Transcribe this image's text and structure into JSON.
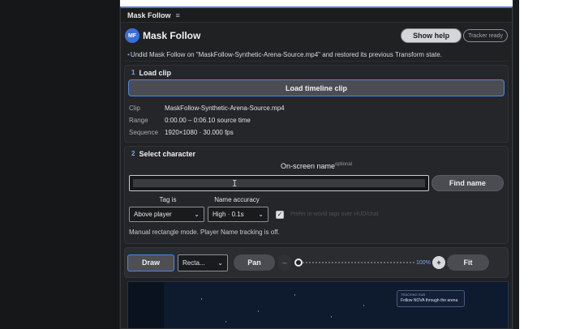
{
  "panel": {
    "tab_title": "Mask Follow"
  },
  "header": {
    "logo_text": "MF",
    "title": "Mask Follow",
    "help_label": "Show help",
    "tracker_status": "Tracker ready"
  },
  "notice": "Undid Mask Follow on \"MaskFollow-Synthetic-Arena-Source.mp4\" and restored its previous Transform state.",
  "load_clip": {
    "step": "1",
    "title": "Load clip",
    "button_label": "Load timeline clip",
    "meta": [
      {
        "key": "Clip",
        "value": "MaskFollow-Synthetic-Arena-Source.mp4"
      },
      {
        "key": "Range",
        "value": "0:00.00 – 0:06.10 source time"
      },
      {
        "key": "Sequence",
        "value": "1920×1080 · 30.000 fps"
      }
    ]
  },
  "select_character": {
    "step": "2",
    "title": "Select character",
    "name_label": "On-screen name",
    "name_optional": "optional",
    "name_value": "",
    "find_label": "Find name",
    "tag_label": "Tag is",
    "accuracy_label": "Name accuracy",
    "tag_value": "Above player",
    "accuracy_value": "High · 0.1s",
    "prefer_label": "Prefer in-world tags over HUD/chat",
    "prefer_checked": true,
    "mode_note": "Manual rectangle mode. Player Name tracking is off."
  },
  "toolbar": {
    "draw_label": "Draw",
    "shape_value": "Recta...",
    "pan_label": "Pan",
    "zoom_out_label": "–",
    "zoom_level": 0.0,
    "zoom_percent": "100%",
    "zoom_in_label": "+",
    "fit_label": "Fit"
  },
  "preview": {
    "overlay_line1": "TRACKING SUB",
    "overlay_line2": "Follow NOVA through the arena"
  }
}
